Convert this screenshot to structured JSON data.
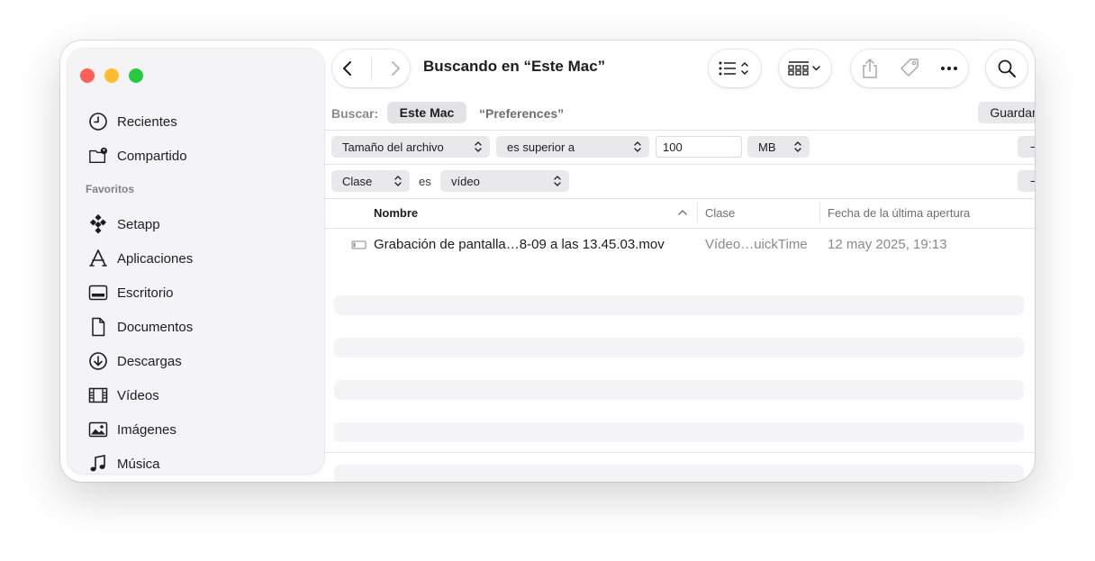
{
  "window": {
    "title": "Buscando en “Este Mac”"
  },
  "sidebar": {
    "items_top": [
      {
        "label": "Recientes",
        "icon": "clock-icon"
      },
      {
        "label": "Compartido",
        "icon": "shared-folder-icon"
      }
    ],
    "section_favorites": "Favoritos",
    "favorites": [
      {
        "label": "Setapp",
        "icon": "setapp-icon"
      },
      {
        "label": "Aplicaciones",
        "icon": "applications-icon"
      },
      {
        "label": "Escritorio",
        "icon": "desktop-icon"
      },
      {
        "label": "Documentos",
        "icon": "document-icon"
      },
      {
        "label": "Descargas",
        "icon": "download-icon"
      },
      {
        "label": "Vídeos",
        "icon": "film-icon"
      },
      {
        "label": "Imágenes",
        "icon": "photo-icon"
      },
      {
        "label": "Música",
        "icon": "music-note-icon"
      }
    ]
  },
  "toolbar": {
    "icons": [
      "back-chevron-icon",
      "forward-chevron-icon",
      "list-view-icon",
      "group-icon",
      "share-icon",
      "tag-icon",
      "more-icon",
      "search-icon"
    ]
  },
  "search": {
    "label": "Buscar:",
    "scope_selected": "Este Mac",
    "scope_other": "“Preferences”",
    "save_label": "Guardar",
    "minus": "−",
    "plus": "+"
  },
  "rules": [
    {
      "attribute": "Tamaño del archivo",
      "operator": "es superior a",
      "value": "100",
      "unit": "MB"
    },
    {
      "attribute": "Clase",
      "operator_text": "es",
      "value": "vídeo"
    }
  ],
  "table": {
    "columns": [
      "Nombre",
      "Clase",
      "Fecha de la última apertura"
    ],
    "rows": [
      {
        "name": "Grabación de pantalla…8-09 a las 13.45.03.mov",
        "kind": "Vídeo…uickTime",
        "date": "12 may 2025, 19:13"
      }
    ]
  },
  "colors": {
    "close": "#fe5f57",
    "minimize": "#febc2e",
    "zoom": "#28c840"
  }
}
